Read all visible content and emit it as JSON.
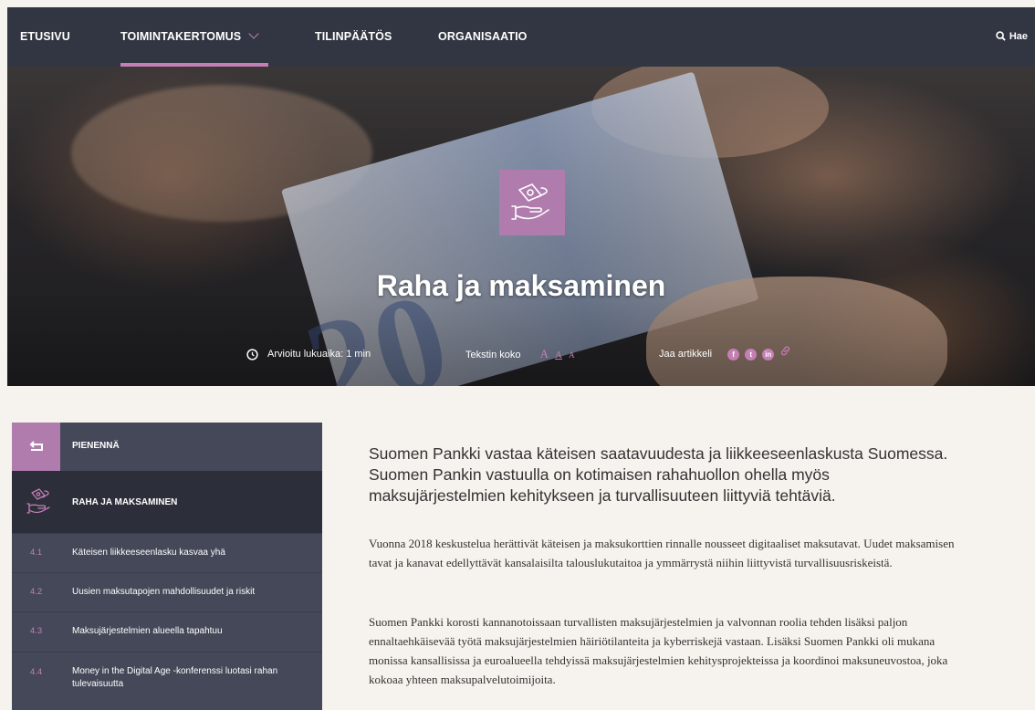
{
  "nav": {
    "items": [
      "ETUSIVU",
      "TOIMINTAKERTOMUS",
      "TILINPÄÄTÖS",
      "ORGANISAATIO"
    ],
    "search_label": "Hae"
  },
  "hero": {
    "title": "Raha ja maksaminen",
    "reading_time": "Arvioitu lukuaika: 1 min",
    "text_size_label": "Tekstin koko",
    "text_size_options": [
      "A",
      "A",
      "A"
    ],
    "share_label": "Jaa artikkeli",
    "share_icons": [
      "facebook-icon",
      "twitter-icon",
      "linkedin-icon",
      "link-icon"
    ]
  },
  "sidebar": {
    "collapse_label": "PIENENNÄ",
    "section_title": "RAHA JA MAKSAMINEN",
    "items": [
      {
        "num": "4.1",
        "label": "Käteisen liikkeeseenlasku kasvaa yhä"
      },
      {
        "num": "4.2",
        "label": "Uusien maksutapojen mahdollisuudet ja riskit"
      },
      {
        "num": "4.3",
        "label": "Maksujärjestelmien alueella tapahtuu"
      },
      {
        "num": "4.4",
        "label": "Money in the Digital Age -konferenssi luotasi rahan tulevaisuutta"
      }
    ]
  },
  "content": {
    "lead": "Suomen Pankki vastaa käteisen saatavuudesta ja liikkeeseenlaskusta Suomessa. Suomen Pankin vastuulla on kotimaisen rahahuollon ohella myös maksujärjestelmien kehitykseen ja turvallisuuteen liittyviä tehtäviä.",
    "paragraphs": [
      "Vuonna 2018 keskustelua herättivät käteisen ja maksukorttien rinnalle nousseet digitaaliset maksutavat. Uudet maksamisen tavat ja kanavat edellyttävät kansalaisilta talouslukutaitoa ja ymmärrystä niihin liittyvistä turvallisuusriskeistä.",
      "Suomen Pankki korosti kannanotoissaan turvallisten maksujärjestelmien ja valvonnan roolia tehden lisäksi paljon ennaltaehkäisevää työtä maksujärjestelmien häiriötilanteita ja kyberriskejä vastaan. Lisäksi Suomen Pankki oli mukana monissa kansallisissa ja euroalueella tehdyissä maksujärjestelmien kehitysprojekteissa ja koordinoi maksuneuvostoa, joka kokoaa yhteen maksupalvelutoimijoita."
    ]
  },
  "colors": {
    "nav_bg": "#323642",
    "accent": "#c47fb5",
    "icon_bg": "#b07cae",
    "sidebar_bg": "#444858",
    "page_bg": "#f6f2ed"
  }
}
